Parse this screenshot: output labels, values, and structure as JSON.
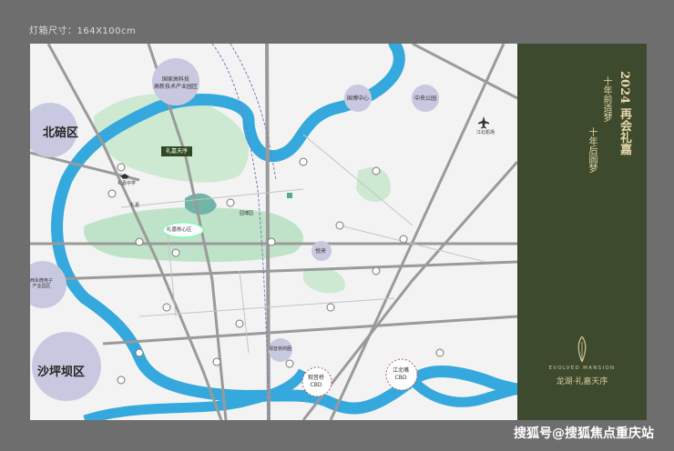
{
  "caption": "灯箱尺寸：164X100cm",
  "watermark": "搜狐号@搜狐焦点重庆站",
  "districts": {
    "beibei": "北碚区",
    "shapingba": "沙坪坝区"
  },
  "circle_labels": {
    "high_tech": "国家高科技\n高新技术产业园区",
    "west_science": "西永微电子\n产业园区",
    "guoda": "国博中心",
    "central_park": "中央公园",
    "guanyin": "观音桥\nCBD",
    "jiangbeizui": "江北嘴\nCBD",
    "lijia_core": "礼嘉核心区",
    "yuelai": "悦来"
  },
  "map_labels": {
    "project_box": "礼嘉天序",
    "station_a": "礼嘉",
    "station_b": "园博园",
    "airport": "江北机场",
    "commerce": "观音桥商圈",
    "school": "礼嘉中学"
  },
  "panel": {
    "year_title": "2024 再会礼嘉",
    "slogan_1": "十年前造梦",
    "slogan_2": "十年后圆梦",
    "brand_en": "EVOLVED MANSION",
    "brand_cn": "龙湖·礼嘉天序"
  },
  "colors": {
    "river": "#35a8dd",
    "green_zone": "#bfe3c8",
    "circle": "#c8c8e0",
    "panel": "#3d4a2e",
    "gold": "#e8d8a8"
  },
  "icons": [
    "airport-icon",
    "school-icon",
    "metro-icon",
    "brand-logo-icon"
  ]
}
